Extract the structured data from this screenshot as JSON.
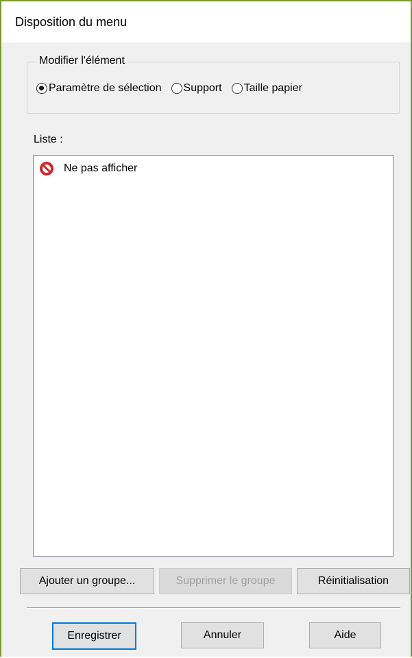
{
  "window": {
    "title": "Disposition du menu"
  },
  "modify_group": {
    "legend": "Modifier l'élément",
    "options": [
      {
        "label": "Paramètre de sélection",
        "selected": true
      },
      {
        "label": "Support",
        "selected": false
      },
      {
        "label": "Taille papier",
        "selected": false
      }
    ]
  },
  "list": {
    "label": "Liste :",
    "items": [
      {
        "icon": "no-entry-icon",
        "label": "Ne pas afficher"
      }
    ]
  },
  "group_buttons": {
    "add_group": "Ajouter un groupe...",
    "delete_group": "Supprimer le groupe",
    "reset": "Réinitialisation"
  },
  "dialog_buttons": {
    "save": "Enregistrer",
    "cancel": "Annuler",
    "help": "Aide"
  },
  "colors": {
    "window_border": "#7a9a2a",
    "focus_border": "#0078d7",
    "no_entry_red": "#d3242b"
  }
}
